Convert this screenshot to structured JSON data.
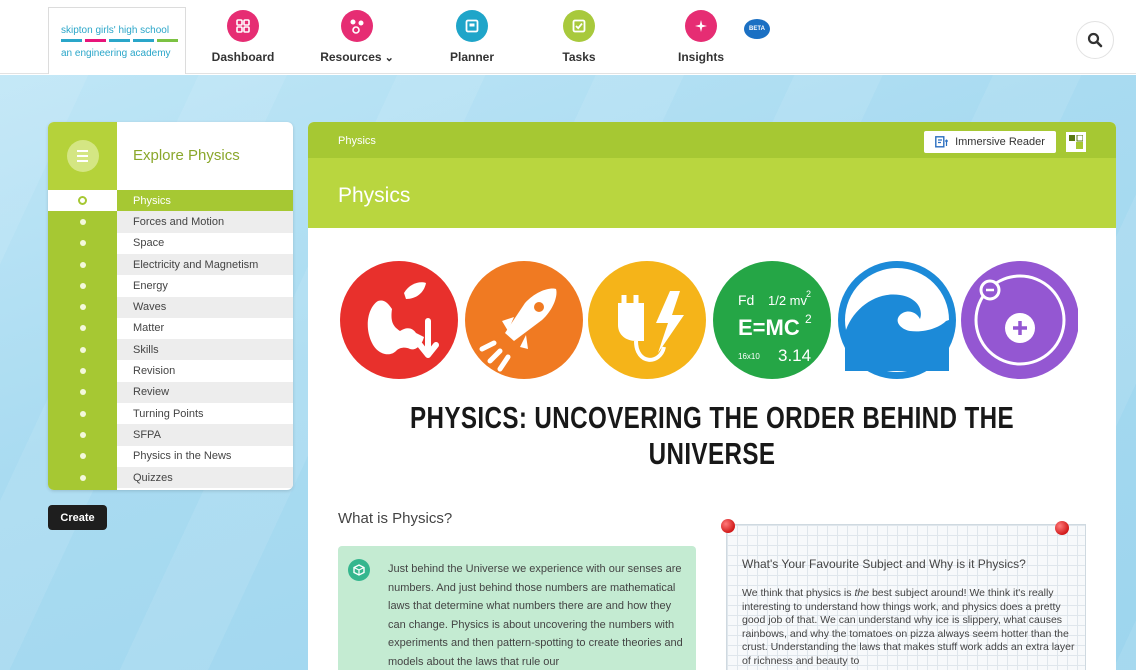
{
  "school": {
    "name_line1": "skipton girls' high school",
    "name_line2": "an engineering academy",
    "stripe_colors": [
      "#2aa6c9",
      "#e8147a",
      "#2aa6c9",
      "#2aa6c9",
      "#7cc243"
    ]
  },
  "nav": {
    "items": [
      {
        "label": "Dashboard",
        "color": "#e62d73",
        "icon": "grid-icon"
      },
      {
        "label": "Resources",
        "color": "#e62d73",
        "icon": "molecule-icon",
        "has_dropdown": true
      },
      {
        "label": "Planner",
        "color": "#1fa5c9",
        "icon": "planner-icon"
      },
      {
        "label": "Tasks",
        "color": "#a8c93c",
        "icon": "checkbox-icon"
      },
      {
        "label": "Insights",
        "color": "#e62d73",
        "icon": "sparkle-icon"
      }
    ],
    "beta": "BETA"
  },
  "sidebar": {
    "title": "Explore Physics",
    "items": [
      {
        "label": "Physics",
        "active": true
      },
      {
        "label": "Forces and Motion"
      },
      {
        "label": "Space"
      },
      {
        "label": "Electricity and Magnetism"
      },
      {
        "label": "Energy"
      },
      {
        "label": "Waves"
      },
      {
        "label": "Matter"
      },
      {
        "label": "Skills"
      },
      {
        "label": "Revision"
      },
      {
        "label": "Review"
      },
      {
        "label": "Turning Points"
      },
      {
        "label": "SFPA"
      },
      {
        "label": "Physics in the News"
      },
      {
        "label": "Quizzes"
      }
    ],
    "create_label": "Create"
  },
  "main": {
    "breadcrumb": "Physics",
    "immersive_reader": "Immersive Reader",
    "title": "Physics",
    "banner": {
      "circle_colors": [
        "#e8302c",
        "#f07a22",
        "#f5b419",
        "#25a646",
        "#1c8ad8",
        "#9457d2"
      ],
      "formula_text": {
        "fd": "Fd",
        "half": "1/2 mv",
        "sq": "2",
        "emc": "E=MC",
        "small": "16x10",
        "pi": "3.14"
      },
      "heading": "PHYSICS: UNCOVERING THE ORDER BEHIND THE UNIVERSE"
    },
    "section_heading": "What is Physics?",
    "intro_text": "Just behind the Universe we experience with our senses are numbers. And just behind those numbers are mathematical laws that determine what numbers there are and how they can change. Physics is about uncovering the numbers with experiments and then pattern-spotting to create theories and models about the laws that rule our",
    "note": {
      "title": "What's Your Favourite Subject and Why is it Physics?",
      "text_before": "We think that physics is ",
      "text_italic": "the",
      "text_after": " best subject around! We think it's really interesting to understand how things work, and physics does a pretty good job of that. We can understand why ice is slippery, what causes rainbows, and why the tomatoes on pizza always seem hotter than the crust. Understanding the laws that makes stuff work adds an extra layer of richness and beauty to"
    }
  }
}
